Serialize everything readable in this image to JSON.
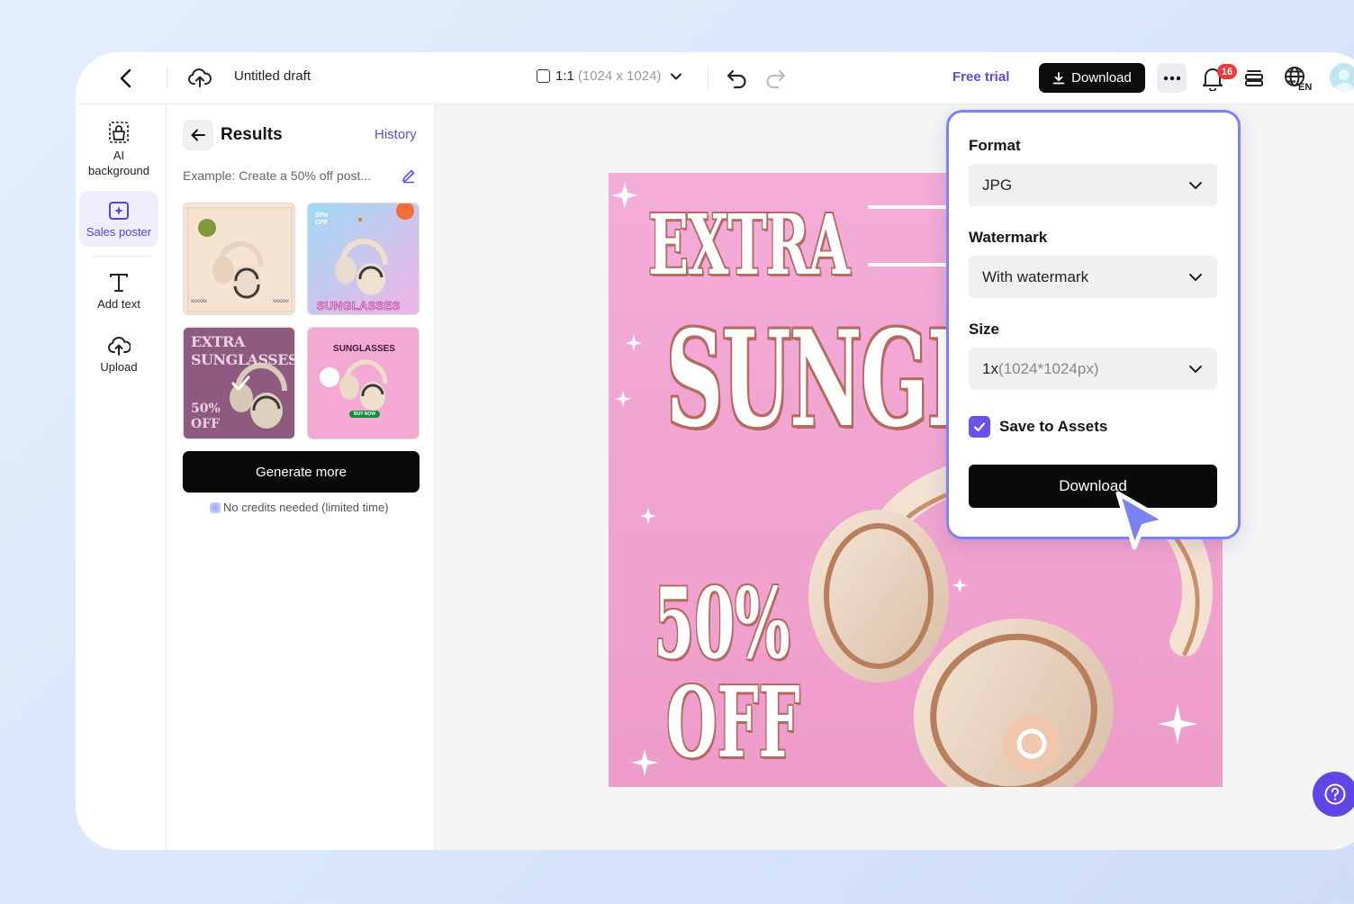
{
  "topbar": {
    "title": "Untitled draft",
    "ratio": "1:1",
    "ratio_dims": "(1024 x 1024)",
    "free_trial": "Free trial",
    "download": "Download",
    "notification_count": "16"
  },
  "rail": {
    "items": [
      {
        "label": "AI background",
        "icon": "shopping-bag-icon"
      },
      {
        "label": "Sales poster",
        "icon": "poster-sparkle-icon",
        "active": true
      },
      {
        "label": "Add text",
        "icon": "text-t-icon"
      },
      {
        "label": "Upload",
        "icon": "cloud-upload-icon"
      }
    ]
  },
  "panel": {
    "title": "Results",
    "history": "History",
    "prompt": "Example: Create a 50% off post...",
    "generate": "Generate more",
    "note": "No credits needed (limited time)",
    "thumbs": [
      {
        "text": "xxxxxx",
        "text2": "xxxxxx"
      },
      {
        "text": "SUNGLASSES",
        "badge": "50% OFF"
      },
      {
        "text": "EXTRA SUNGLASSES",
        "text2": "50% OFF",
        "selected": true
      },
      {
        "text": "SUNGLASSES",
        "button": "BUY NOW"
      }
    ]
  },
  "poster": {
    "line1": "EXTRA",
    "line2": "SUNGLASSES",
    "line3": "50%",
    "line4": "OFF"
  },
  "popover": {
    "format_label": "Format",
    "format_value": "JPG",
    "watermark_label": "Watermark",
    "watermark_value": "With watermark",
    "size_label": "Size",
    "size_value": "1x",
    "size_detail": "(1024*1024px)",
    "save_label": "Save to Assets",
    "save_checked": true,
    "download": "Download"
  },
  "colors": {
    "accent": "#6348e8",
    "poster_pink": "#ef9fd0",
    "notification_red": "#f03b3b"
  }
}
